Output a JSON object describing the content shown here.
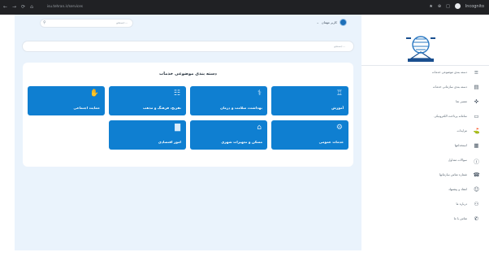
{
  "browser": {
    "nav_icons": [
      "←",
      "→",
      "⟳",
      "⌂"
    ],
    "url": "isu.tehran.ir/services",
    "right_icons": [
      "★",
      "⊕",
      "□"
    ],
    "profile_label": "Incognito"
  },
  "header": {
    "search_placeholder": "جستجو...",
    "user_name": "کاربر مهمان",
    "user_chevron": "⌄"
  },
  "main_search": {
    "placeholder": "جستجو..."
  },
  "panel": {
    "title": "دسته بندی موضوعی خدمات",
    "tiles": [
      {
        "label": "آموزش",
        "icon": "♖"
      },
      {
        "label": "بهداشت، سلامت و درمان",
        "icon": "⚕"
      },
      {
        "label": "تفریح، فرهنگ و مذهب",
        "icon": "☷"
      },
      {
        "label": "حمایت اجتماعی",
        "icon": "✋"
      },
      {
        "label": "خدمات عمومی",
        "icon": "⚙"
      },
      {
        "label": "مسکن و تجهیزات شهری",
        "icon": "⌂"
      },
      {
        "label": "امور اقتصادی",
        "icon": "▇"
      }
    ]
  },
  "sidebar": {
    "items": [
      {
        "label": "دسته بندی موضوعی خدمات",
        "icon": "≡"
      },
      {
        "label": "دسته بندی سازمانی خدمات",
        "icon": "▤"
      },
      {
        "label": "مسیر نما",
        "icon": "✜"
      },
      {
        "label": "سامانه پرداخت الکترونیکی",
        "icon": "▭"
      },
      {
        "label": "مزایدات",
        "icon": "⛳"
      },
      {
        "label": "استخدامها",
        "icon": "▦"
      },
      {
        "label": "سوالات متداول",
        "icon": "ⓘ"
      },
      {
        "label": "شماره تماس سازمانها",
        "icon": "☎"
      },
      {
        "label": "انتقاد و پیشنهاد",
        "icon": "☺"
      },
      {
        "label": "درباره ما",
        "icon": "⚇"
      },
      {
        "label": "تماس با ما",
        "icon": "✆"
      }
    ]
  },
  "colors": {
    "accent": "#0f7fd1",
    "main_bg": "#eaf3fc"
  }
}
